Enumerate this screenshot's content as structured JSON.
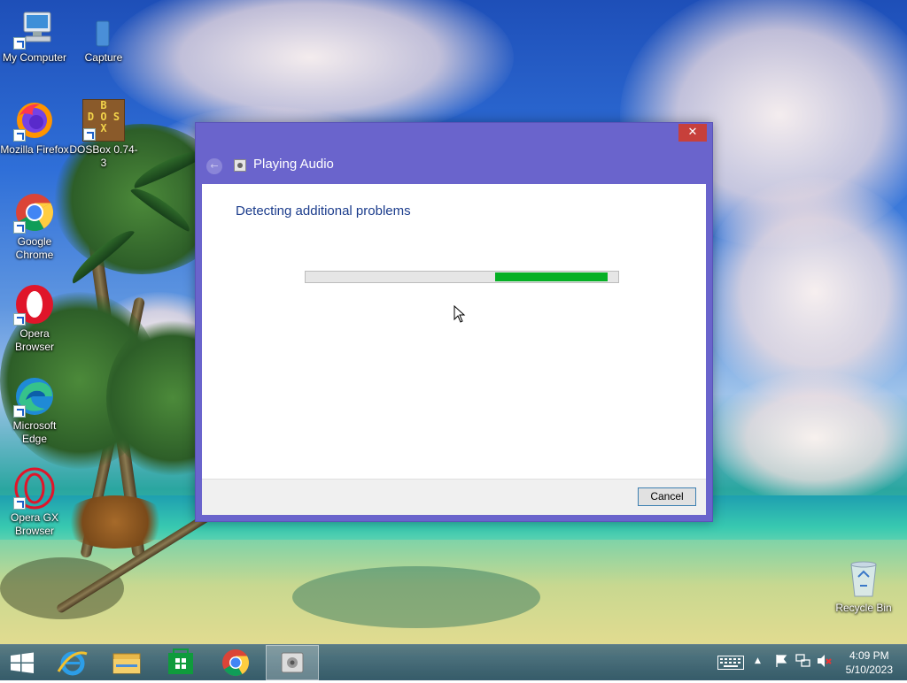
{
  "desktop": {
    "icons": [
      {
        "label": "My Computer",
        "icon": "computer-icon"
      },
      {
        "label": "Capture",
        "icon": "folder-icon"
      },
      {
        "label": "Mozilla Firefox",
        "icon": "firefox-icon"
      },
      {
        "label": "DOSBox 0.74-3",
        "icon": "dosbox-icon"
      },
      {
        "label": "Google Chrome",
        "icon": "chrome-icon"
      },
      {
        "label": "Opera Browser",
        "icon": "opera-icon"
      },
      {
        "label": "Microsoft Edge",
        "icon": "edge-icon"
      },
      {
        "label": "Opera GX Browser",
        "icon": "opera-gx-icon"
      },
      {
        "label": "Recycle Bin",
        "icon": "recycle-bin-icon"
      }
    ],
    "dosbox_logo": {
      "letters": [
        "B",
        "D",
        "O",
        "S",
        "X"
      ]
    }
  },
  "dialog": {
    "title": "Playing Audio",
    "close_glyph": "✕",
    "back_glyph": "←",
    "heading": "Detecting additional problems",
    "progress": {
      "start": 0.605,
      "end": 0.965,
      "color": "#06b025"
    },
    "cancel_label": "Cancel",
    "accent_color": "#6a64cc"
  },
  "taskbar": {
    "start_icon": "windows-start-icon",
    "pinned": [
      {
        "name": "internet-explorer-icon"
      },
      {
        "name": "file-explorer-icon"
      },
      {
        "name": "store-icon"
      },
      {
        "name": "chrome-icon"
      },
      {
        "name": "troubleshooter-icon",
        "active": true
      }
    ],
    "tray": {
      "keyboard_icon": "keyboard-icon",
      "show_hidden_glyph": "▲",
      "flag_icon": "action-center-flag-icon",
      "network_icon": "network-icon",
      "volume_icon": "volume-muted-icon"
    },
    "time": "4:09 PM",
    "date": "5/10/2023"
  }
}
